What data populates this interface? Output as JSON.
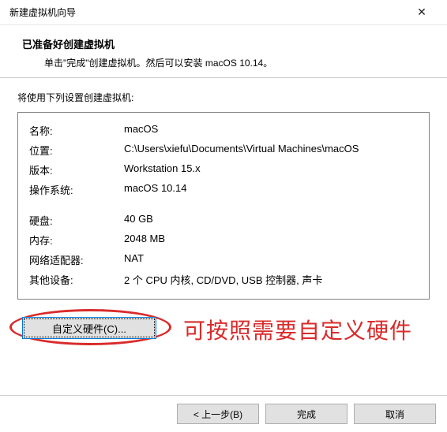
{
  "window": {
    "title": "新建虚拟机向导",
    "close_icon": "✕"
  },
  "header": {
    "title": "已准备好创建虚拟机",
    "subtitle": "单击\"完成\"创建虚拟机。然后可以安装 macOS 10.14。"
  },
  "lead": "将使用下列设置创建虚拟机:",
  "settings": {
    "name_label": "名称:",
    "name_value": "macOS",
    "location_label": "位置:",
    "location_value": "C:\\Users\\xiefu\\Documents\\Virtual Machines\\macOS",
    "version_label": "版本:",
    "version_value": "Workstation 15.x",
    "os_label": "操作系统:",
    "os_value": "macOS 10.14",
    "disk_label": "硬盘:",
    "disk_value": "40 GB",
    "memory_label": "内存:",
    "memory_value": "2048 MB",
    "net_label": "网络适配器:",
    "net_value": "NAT",
    "other_label": "其他设备:",
    "other_value": "2 个 CPU 内核, CD/DVD, USB 控制器, 声卡"
  },
  "customize_label": "自定义硬件(C)...",
  "annotation": "可按照需要自定义硬件",
  "footer": {
    "back": "< 上一步(B)",
    "finish": "完成",
    "cancel": "取消"
  }
}
